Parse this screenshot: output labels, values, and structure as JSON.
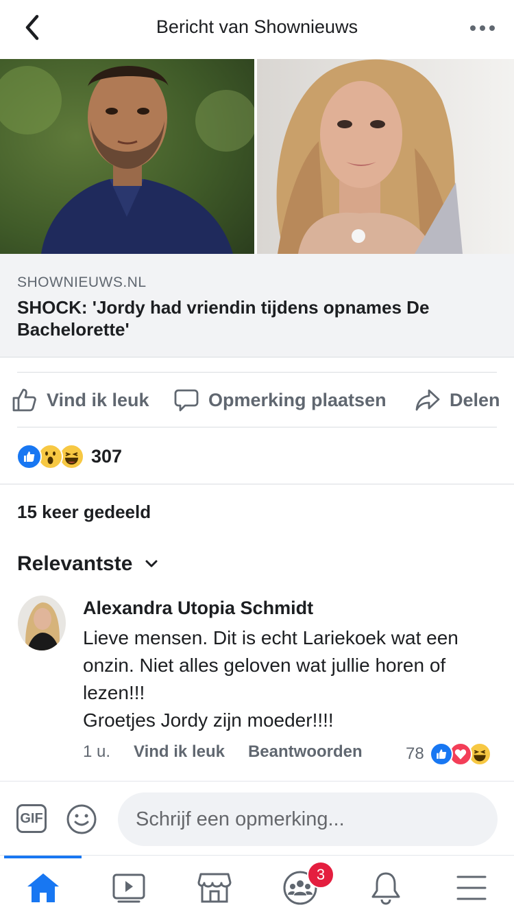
{
  "header": {
    "title": "Bericht van Shownieuws"
  },
  "link_preview": {
    "domain": "SHOWNIEUWS.NL",
    "headline": "SHOCK: 'Jordy had vriendin tijdens opnames De Bachelorette'"
  },
  "actions": {
    "like": "Vind ik leuk",
    "comment": "Opmerking plaatsen",
    "share": "Delen"
  },
  "reactions": {
    "types": [
      "like",
      "wow",
      "haha"
    ],
    "count": "307"
  },
  "shares": "15 keer gedeeld",
  "sort": {
    "label": "Relevantste"
  },
  "comment": {
    "author": "Alexandra Utopia Schmidt",
    "lines": [
      "Lieve mensen. Dit is echt Lariekoek wat een",
      "onzin. Niet alles geloven wat jullie horen of",
      "lezen!!!",
      "Groetjes Jordy zijn moeder!!!!"
    ],
    "time": "1 u.",
    "like": "Vind ik leuk",
    "reply": "Beantwoorden",
    "reaction_count": "78",
    "reaction_types": [
      "like",
      "love",
      "haha"
    ]
  },
  "composer": {
    "gif": "GIF",
    "placeholder": "Schrijf een opmerking..."
  },
  "tabbar": {
    "items": [
      "home-icon",
      "video-icon",
      "marketplace-icon",
      "groups-icon",
      "notifications-icon",
      "menu-icon"
    ],
    "groups_badge": "3"
  },
  "colors": {
    "accent": "#1877f2",
    "badge": "#e41e3f",
    "text_secondary": "#606770"
  }
}
